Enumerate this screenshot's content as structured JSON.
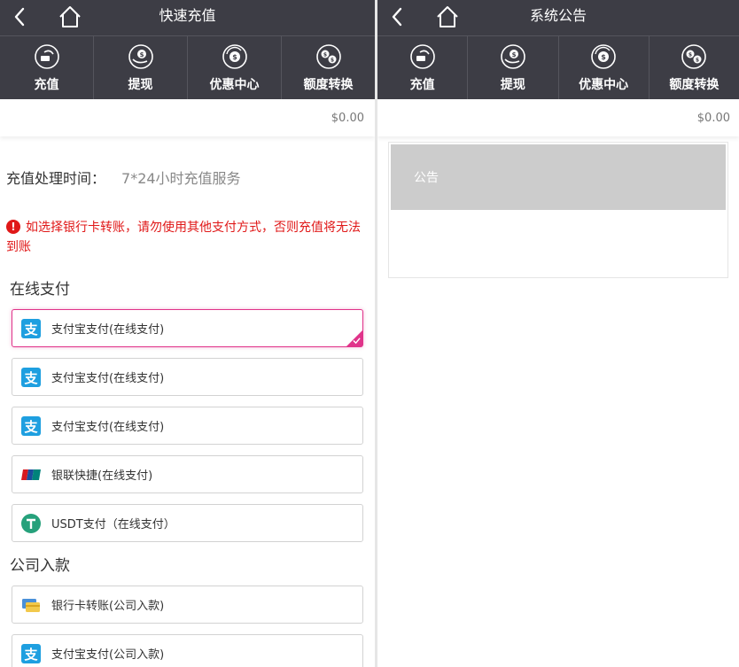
{
  "left": {
    "header": {
      "title": "快速充值"
    },
    "nav": [
      {
        "label": "充值",
        "icon": "card-hand-icon"
      },
      {
        "label": "提现",
        "icon": "coin-hand-icon"
      },
      {
        "label": "优惠中心",
        "icon": "coin-cycle-icon"
      },
      {
        "label": "额度转换",
        "icon": "coin-exchange-icon"
      }
    ],
    "balance": "$0.00",
    "time_label": "充值处理时间：",
    "time_value": "7*24小时充值服务",
    "warning": "如选择银行卡转账，请勿使用其他支付方式，否则充值将无法到账",
    "online_title": "在线支付",
    "online_methods": [
      {
        "label": "支付宝支付(在线支付)",
        "icon": "alipay-icon",
        "selected": true
      },
      {
        "label": "支付宝支付(在线支付)",
        "icon": "alipay-icon"
      },
      {
        "label": "支付宝支付(在线支付)",
        "icon": "alipay-icon"
      },
      {
        "label": "银联快捷(在线支付)",
        "icon": "unionpay-icon"
      },
      {
        "label": "USDT支付（在线支付）",
        "icon": "usdt-icon"
      }
    ],
    "company_title": "公司入款",
    "company_methods": [
      {
        "label": "银行卡转账(公司入款)",
        "icon": "bank-card-icon"
      },
      {
        "label": "支付宝支付(公司入款)",
        "icon": "alipay-icon"
      }
    ]
  },
  "right": {
    "header": {
      "title": "系统公告"
    },
    "nav": [
      {
        "label": "充值",
        "icon": "card-hand-icon"
      },
      {
        "label": "提现",
        "icon": "coin-hand-icon"
      },
      {
        "label": "优惠中心",
        "icon": "coin-cycle-icon"
      },
      {
        "label": "额度转换",
        "icon": "coin-exchange-icon"
      }
    ],
    "balance": "$0.00",
    "notice_title": "公告"
  },
  "colors": {
    "header_bg": "#3d3d45",
    "accent_pink": "#e0338a",
    "warning_red": "#e01818",
    "alipay_blue": "#1e9fe0",
    "usdt_green": "#26a17b"
  }
}
